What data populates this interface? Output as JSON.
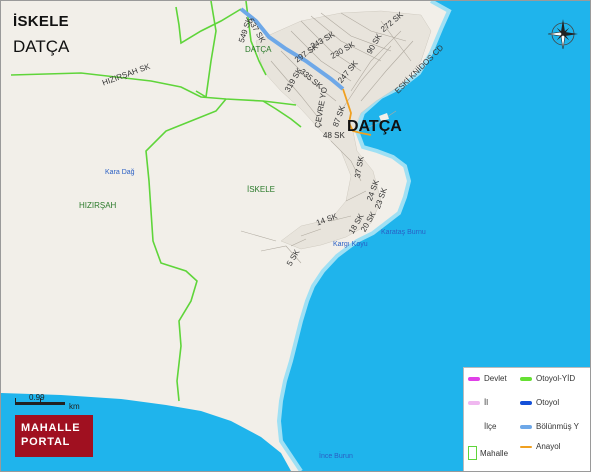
{
  "title": {
    "line1": "İSKELE",
    "line2": "DATÇA"
  },
  "city_label": "DATÇA",
  "places": {
    "iskele": "İSKELE",
    "hizirsah": "HIZIRŞAH",
    "datca_small": "DATÇA"
  },
  "pois": {
    "kara_dag": "Kara Dağ",
    "karatas_burnu": "Karataş Burnu",
    "kargi_koyu": "Kargı Koyu",
    "ince_burun": "İnce Burun"
  },
  "streets": {
    "hizirsah_sk": "HIZIRŞAH SK",
    "s549": "549 SK",
    "s537": "537 SK",
    "s243": "243 SK",
    "s230": "230 SK",
    "s272": "272 SK",
    "s297": "297 SK",
    "s335": "335 SK",
    "s247": "247 SK",
    "s319": "319 SK",
    "eski_knidos": "ESKİ KNİDOS CD",
    "cevre": "ÇEVRE YO",
    "s87": "87 SK",
    "s48": "48 SK",
    "s37": "37 SK",
    "s24": "24 SK",
    "s23": "23 SK",
    "s14": "14 SK",
    "s18": "18 SK",
    "s20": "20 SK",
    "s5": "5 SK",
    "s90": "90 SK"
  },
  "scale": {
    "value": "0.99",
    "unit": "km"
  },
  "logo": {
    "line1": "MAHALLE",
    "line2": "PORTAL"
  },
  "legend": {
    "devlet": "Devlet",
    "otoyol_yid": "Otoyol-YİD",
    "il": "İl",
    "otoyol": "Otoyol",
    "ilce": "İlçe",
    "bolunmus": "Bölünmüş Y",
    "mahalle": "Mahalle",
    "anayol": "Anayol"
  },
  "colors": {
    "sea": "#1fb4ec",
    "land": "#f2efe9",
    "boundary": "#5fd53a",
    "devlet": "#e040e8",
    "otoyol_yid": "#66e033",
    "il": "#f0b8f0",
    "otoyol": "#1450d8",
    "bolunmus": "#6ea8e8",
    "anayol": "#f0a020",
    "logo": "#a01020"
  }
}
